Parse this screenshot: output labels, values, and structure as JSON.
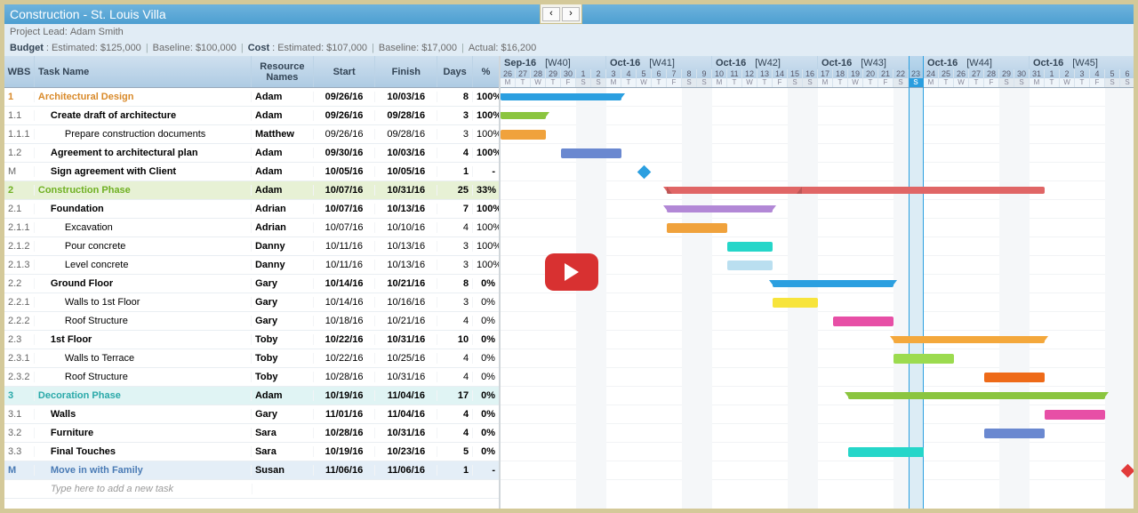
{
  "title": "Construction - St. Louis Villa",
  "projectLeadLabel": "Project Lead:",
  "projectLead": "Adam Smith",
  "budget": {
    "label": "Budget",
    "est_l": "Estimated:",
    "est": "$125,000",
    "base_l": "Baseline:",
    "base": "$100,000"
  },
  "cost": {
    "label": "Cost",
    "est_l": "Estimated:",
    "est": "$107,000",
    "base_l": "Baseline:",
    "base": "$17,000",
    "act_l": "Actual:",
    "act": "$16,200"
  },
  "cols": {
    "wbs": "WBS",
    "name": "Task Name",
    "res": "Resource Names",
    "start": "Start",
    "fin": "Finish",
    "days": "Days",
    "pct": "%"
  },
  "placeholder": "Type here to add a new task",
  "timeline": {
    "weeks": [
      {
        "m": "Sep-16",
        "w": "[W40]"
      },
      {
        "m": "Oct-16",
        "w": "[W41]"
      },
      {
        "m": "Oct-16",
        "w": "[W42]"
      },
      {
        "m": "Oct-16",
        "w": "[W43]"
      },
      {
        "m": "Oct-16",
        "w": "[W44]"
      },
      {
        "m": "Oct-16",
        "w": "[W45]"
      }
    ],
    "days": [
      "26",
      "27",
      "28",
      "29",
      "30",
      "1",
      "2",
      "3",
      "4",
      "5",
      "6",
      "7",
      "8",
      "9",
      "10",
      "11",
      "12",
      "13",
      "14",
      "15",
      "16",
      "17",
      "18",
      "19",
      "20",
      "21",
      "22",
      "23",
      "24",
      "25",
      "26",
      "27",
      "28",
      "29",
      "30",
      "31",
      "1",
      "2",
      "3",
      "4",
      "5",
      "6"
    ],
    "dow": [
      "M",
      "T",
      "W",
      "T",
      "F",
      "S",
      "S",
      "M",
      "T",
      "W",
      "T",
      "F",
      "S",
      "S",
      "M",
      "T",
      "W",
      "T",
      "F",
      "S",
      "S",
      "M",
      "T",
      "W",
      "T",
      "F",
      "S",
      "S",
      "M",
      "T",
      "W",
      "T",
      "F",
      "S",
      "S",
      "M",
      "T",
      "W",
      "T",
      "F",
      "S",
      "S"
    ],
    "todayIndex": 27
  },
  "tasks": [
    {
      "wbs": "1",
      "name": "Architectural Design",
      "res": "Adam",
      "start": "09/26/16",
      "fin": "10/03/16",
      "days": "8",
      "pct": "100%",
      "lvl": 0,
      "fg": "orange",
      "bg": "none",
      "barStart": 0,
      "barLen": 8,
      "type": "sum",
      "color": "blue"
    },
    {
      "wbs": "1.1",
      "name": "Create draft of architecture",
      "res": "Adam",
      "start": "09/26/16",
      "fin": "09/28/16",
      "days": "3",
      "pct": "100%",
      "lvl": 1,
      "bg": "none",
      "barStart": 0,
      "barLen": 3,
      "type": "sum",
      "color": "lime"
    },
    {
      "wbs": "1.1.1",
      "name": "Prepare construction documents",
      "res": "Matthew",
      "start": "09/26/16",
      "fin": "09/28/16",
      "days": "3",
      "pct": "100%",
      "lvl": 2,
      "bg": "none",
      "barStart": 0,
      "barLen": 3,
      "type": "bar",
      "color": "orange"
    },
    {
      "wbs": "1.2",
      "name": "Agreement to architectural plan",
      "res": "Adam",
      "start": "09/30/16",
      "fin": "10/03/16",
      "days": "4",
      "pct": "100%",
      "lvl": 1,
      "bg": "none",
      "barStart": 4,
      "barLen": 4,
      "type": "bar",
      "color": "slate"
    },
    {
      "wbs": "M",
      "name": "Sign agreement with Client",
      "res": "Adam",
      "start": "10/05/16",
      "fin": "10/05/16",
      "days": "1",
      "pct": "-",
      "lvl": 1,
      "bg": "none",
      "barStart": 9,
      "barLen": 1,
      "type": "mile",
      "color": "blue"
    },
    {
      "wbs": "2",
      "name": "Construction Phase",
      "res": "Adam",
      "start": "10/07/16",
      "fin": "10/31/16",
      "days": "25",
      "pct": "33%",
      "lvl": 0,
      "fg": "green",
      "bg": "green",
      "barStart": 11,
      "barLen": 25,
      "type": "sum",
      "color": "red",
      "prog": 33
    },
    {
      "wbs": "2.1",
      "name": "Foundation",
      "res": "Adrian",
      "start": "10/07/16",
      "fin": "10/13/16",
      "days": "7",
      "pct": "100%",
      "lvl": 1,
      "bg": "none",
      "barStart": 11,
      "barLen": 7,
      "type": "sum",
      "color": "purple"
    },
    {
      "wbs": "2.1.1",
      "name": "Excavation",
      "res": "Adrian",
      "start": "10/07/16",
      "fin": "10/10/16",
      "days": "4",
      "pct": "100%",
      "lvl": 2,
      "bg": "none",
      "barStart": 11,
      "barLen": 4,
      "type": "bar",
      "color": "orange"
    },
    {
      "wbs": "2.1.2",
      "name": "Pour concrete",
      "res": "Danny",
      "start": "10/11/16",
      "fin": "10/13/16",
      "days": "3",
      "pct": "100%",
      "lvl": 2,
      "bg": "none",
      "barStart": 15,
      "barLen": 3,
      "type": "bar",
      "color": "cyan"
    },
    {
      "wbs": "2.1.3",
      "name": "Level concrete",
      "res": "Danny",
      "start": "10/11/16",
      "fin": "10/13/16",
      "days": "3",
      "pct": "100%",
      "lvl": 2,
      "bg": "none",
      "barStart": 15,
      "barLen": 3,
      "type": "bar",
      "color": "ltcyan"
    },
    {
      "wbs": "2.2",
      "name": "Ground Floor",
      "res": "Gary",
      "start": "10/14/16",
      "fin": "10/21/16",
      "days": "8",
      "pct": "0%",
      "lvl": 1,
      "bg": "none",
      "barStart": 18,
      "barLen": 8,
      "type": "sum",
      "color": "blue"
    },
    {
      "wbs": "2.2.1",
      "name": "Walls to 1st Floor",
      "res": "Gary",
      "start": "10/14/16",
      "fin": "10/16/16",
      "days": "3",
      "pct": "0%",
      "lvl": 2,
      "bg": "none",
      "barStart": 18,
      "barLen": 3,
      "type": "bar",
      "color": "yellow"
    },
    {
      "wbs": "2.2.2",
      "name": "Roof Structure",
      "res": "Gary",
      "start": "10/18/16",
      "fin": "10/21/16",
      "days": "4",
      "pct": "0%",
      "lvl": 2,
      "bg": "none",
      "barStart": 22,
      "barLen": 4,
      "type": "bar",
      "color": "magenta"
    },
    {
      "wbs": "2.3",
      "name": "1st Floor",
      "res": "Toby",
      "start": "10/22/16",
      "fin": "10/31/16",
      "days": "10",
      "pct": "0%",
      "lvl": 1,
      "bg": "none",
      "barStart": 26,
      "barLen": 10,
      "type": "sum",
      "color": "orangeA"
    },
    {
      "wbs": "2.3.1",
      "name": "Walls to Terrace",
      "res": "Toby",
      "start": "10/22/16",
      "fin": "10/25/16",
      "days": "4",
      "pct": "0%",
      "lvl": 2,
      "bg": "none",
      "barStart": 26,
      "barLen": 4,
      "type": "bar",
      "color": "green2"
    },
    {
      "wbs": "2.3.2",
      "name": "Roof Structure",
      "res": "Toby",
      "start": "10/28/16",
      "fin": "10/31/16",
      "days": "4",
      "pct": "0%",
      "lvl": 2,
      "bg": "none",
      "barStart": 32,
      "barLen": 4,
      "type": "bar",
      "color": "orange2"
    },
    {
      "wbs": "3",
      "name": "Decoration Phase",
      "res": "Adam",
      "start": "10/19/16",
      "fin": "11/04/16",
      "days": "17",
      "pct": "0%",
      "lvl": 0,
      "fg": "cyan",
      "bg": "cyan",
      "barStart": 23,
      "barLen": 17,
      "type": "sum",
      "color": "lime"
    },
    {
      "wbs": "3.1",
      "name": "Walls",
      "res": "Gary",
      "start": "11/01/16",
      "fin": "11/04/16",
      "days": "4",
      "pct": "0%",
      "lvl": 1,
      "bg": "none",
      "barStart": 36,
      "barLen": 4,
      "type": "bar",
      "color": "magenta"
    },
    {
      "wbs": "3.2",
      "name": "Furniture",
      "res": "Sara",
      "start": "10/28/16",
      "fin": "10/31/16",
      "days": "4",
      "pct": "0%",
      "lvl": 1,
      "bg": "none",
      "barStart": 32,
      "barLen": 4,
      "type": "bar",
      "color": "slate"
    },
    {
      "wbs": "3.3",
      "name": "Final Touches",
      "res": "Sara",
      "start": "10/19/16",
      "fin": "10/23/16",
      "days": "5",
      "pct": "0%",
      "lvl": 1,
      "bg": "none",
      "barStart": 23,
      "barLen": 5,
      "type": "bar",
      "color": "cyan"
    },
    {
      "wbs": "M",
      "name": "Move in with Family",
      "res": "Susan",
      "start": "11/06/16",
      "fin": "11/06/16",
      "days": "1",
      "pct": "-",
      "lvl": 1,
      "fg": "blue",
      "bg": "blue",
      "barStart": 41,
      "barLen": 1,
      "type": "mile",
      "color": "red2"
    }
  ]
}
